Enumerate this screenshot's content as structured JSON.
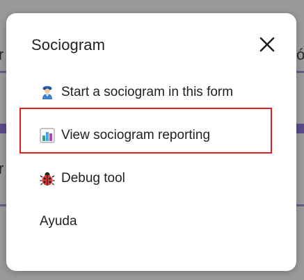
{
  "dialog": {
    "title": "Sociogram",
    "close_icon": "close-icon"
  },
  "menu": {
    "items": [
      {
        "label": "Start a sociogram in this form",
        "icon": "person-icon"
      },
      {
        "label": "View sociogram reporting",
        "icon": "bar-chart-icon"
      },
      {
        "label": "Debug tool",
        "icon": "ladybug-icon"
      },
      {
        "label": "Ayuda",
        "icon": ""
      }
    ]
  },
  "background": {
    "edge_left_top": "r",
    "edge_right_top": "ó",
    "edge_left_mid": "r"
  },
  "colors": {
    "accent_purple": "#5e35b1",
    "highlight_red": "#e02020",
    "backdrop": "#9a9a9a"
  }
}
